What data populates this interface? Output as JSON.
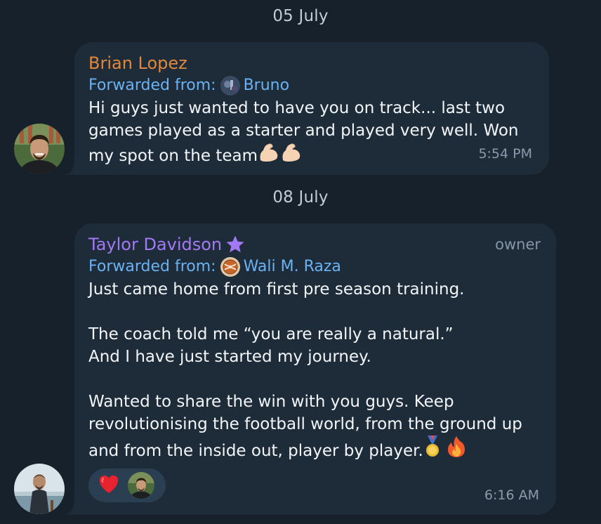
{
  "date_separators": [
    "05 July",
    "08 July"
  ],
  "messages": [
    {
      "sender": "Brian Lopez",
      "forwarded_label": "Forwarded from:",
      "forwarded_name": "Bruno",
      "lines": [
        "Hi guys just wanted to have you on track... last two",
        "games played as a starter and played very well. Won",
        "my spot on the team"
      ],
      "emoji": [
        "flexed-biceps-icon",
        "flexed-biceps-icon"
      ],
      "time": "5:54 PM",
      "colors": {
        "sender": "#e1873b"
      }
    },
    {
      "sender": "Taylor Davidson",
      "badge": "owner",
      "forwarded_label": "Forwarded from:",
      "forwarded_name": "Wali M. Raza",
      "paragraphs": [
        "Just came home from first pre season training.",
        "The coach told me “you are really a natural.”\nAnd I have just started my journey.",
        "Wanted to share the win with you guys. Keep\nrevolutionising the football world, from the ground up\nand from the inside out, player by player."
      ],
      "emoji": [
        "medal-icon",
        "fire-icon"
      ],
      "reaction": "heart-icon",
      "time": "6:16 AM",
      "colors": {
        "sender": "#a378f4"
      }
    }
  ],
  "colors": {
    "background": "#17212b",
    "bubble": "#1e2c3a",
    "link": "#6ab2f2",
    "reaction_pill": "#2b3f52"
  }
}
